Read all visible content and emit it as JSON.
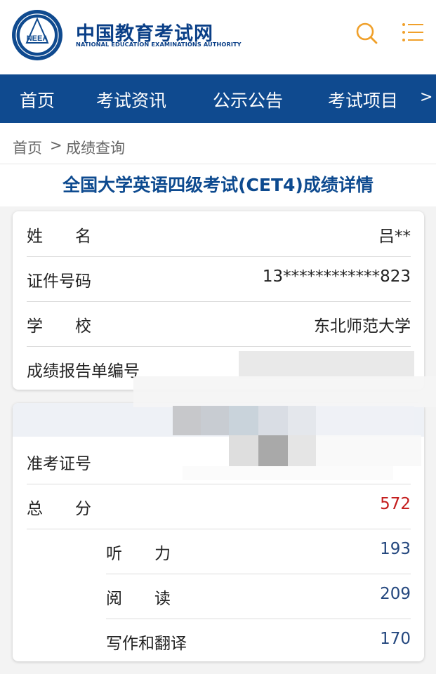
{
  "header": {
    "logo_text": "NEEA",
    "site_name": "中国教育考试网",
    "site_subtitle": "NATIONAL EDUCATION EXAMINATIONS AUTHORITY",
    "search_icon": "search-icon",
    "menu_icon": "menu-icon",
    "accent_color": "#f0a02a",
    "brand_color": "#0f4a8f"
  },
  "nav": {
    "items": [
      "首页",
      "考试资讯",
      "公示公告",
      "考试项目"
    ],
    "more": ">"
  },
  "breadcrumb": {
    "home": "首页",
    "separator": ">",
    "current": "成绩查询"
  },
  "page_title": "全国大学英语四级考试(CET4)成绩详情",
  "personal": {
    "name_label": "姓　　名",
    "name_value": "吕**",
    "id_label": "证件号码",
    "id_value": "13************823",
    "school_label": "学　　校",
    "school_value": "东北师范大学",
    "report_label": "成绩报告单编号",
    "report_value": ""
  },
  "scores": {
    "admission_label": "准考证号",
    "admission_value": "",
    "total_label": "总　　分",
    "total_value": "572",
    "listening_label": "听　　力",
    "listening_value": "193",
    "reading_label": "阅　　读",
    "reading_value": "209",
    "writing_label": "写作和翻译",
    "writing_value": "170"
  }
}
